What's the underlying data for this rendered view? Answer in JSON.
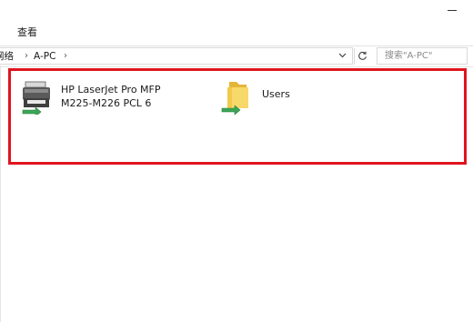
{
  "window": {
    "ribbon_tab": "查看"
  },
  "address_bar": {
    "crumbs": [
      "网络",
      "A-PC"
    ],
    "separator": "›",
    "dropdown_icon": "chevron-down",
    "refresh_icon": "refresh"
  },
  "search": {
    "placeholder": "搜索\"A-PC\""
  },
  "items": [
    {
      "label": "HP LaserJet Pro MFP\nM225-M226 PCL 6",
      "icon": "network-printer-icon"
    },
    {
      "label": "Users",
      "icon": "shared-folder-icon"
    }
  ],
  "colors": {
    "highlight": "#e0141e",
    "share_arrow": "#3aa655",
    "folder": "#f2c94c"
  }
}
